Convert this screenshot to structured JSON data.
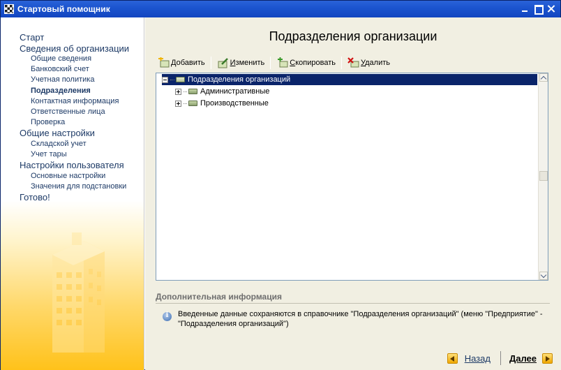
{
  "window": {
    "title": "Стартовый помощник"
  },
  "sidebar": {
    "items": [
      {
        "label": "Старт",
        "level": 1,
        "active": false
      },
      {
        "label": "Сведения об организации",
        "level": 1,
        "active": false
      },
      {
        "label": "Общие сведения",
        "level": 2,
        "active": false
      },
      {
        "label": "Банковский счет",
        "level": 2,
        "active": false
      },
      {
        "label": "Учетная политика",
        "level": 2,
        "active": false
      },
      {
        "label": "Подразделения",
        "level": 2,
        "active": true
      },
      {
        "label": "Контактная информация",
        "level": 2,
        "active": false
      },
      {
        "label": "Ответственные лица",
        "level": 2,
        "active": false
      },
      {
        "label": "Проверка",
        "level": 2,
        "active": false
      },
      {
        "label": "Общие настройки",
        "level": 1,
        "active": false
      },
      {
        "label": "Складской учет",
        "level": 2,
        "active": false
      },
      {
        "label": "Учет тары",
        "level": 2,
        "active": false
      },
      {
        "label": "Настройки пользователя",
        "level": 1,
        "active": false
      },
      {
        "label": "Основные настройки",
        "level": 2,
        "active": false
      },
      {
        "label": "Значения для подстановки",
        "level": 2,
        "active": false
      },
      {
        "label": "Готово!",
        "level": 1,
        "active": false
      }
    ]
  },
  "main": {
    "title": "Подразделения организации",
    "toolbar": {
      "add": "Добавить",
      "edit": "Изменить",
      "copy": "Скопировать",
      "delete": "Удалить"
    },
    "tree": {
      "root": "Подразделения организаций",
      "children": [
        "Административные",
        "Производственные"
      ]
    },
    "info": {
      "header": "Дополнительная информация",
      "text": "Введенные данные сохраняются в справочнике \"Подразделения организаций\" (меню \"Предприятие\" - \"Подразделения организаций\")"
    },
    "nav": {
      "back": "Назад",
      "next": "Далее"
    }
  },
  "colors": {
    "titlebar": "#1c55cf",
    "selection": "#0a246a",
    "accent": "#ffc21a"
  }
}
